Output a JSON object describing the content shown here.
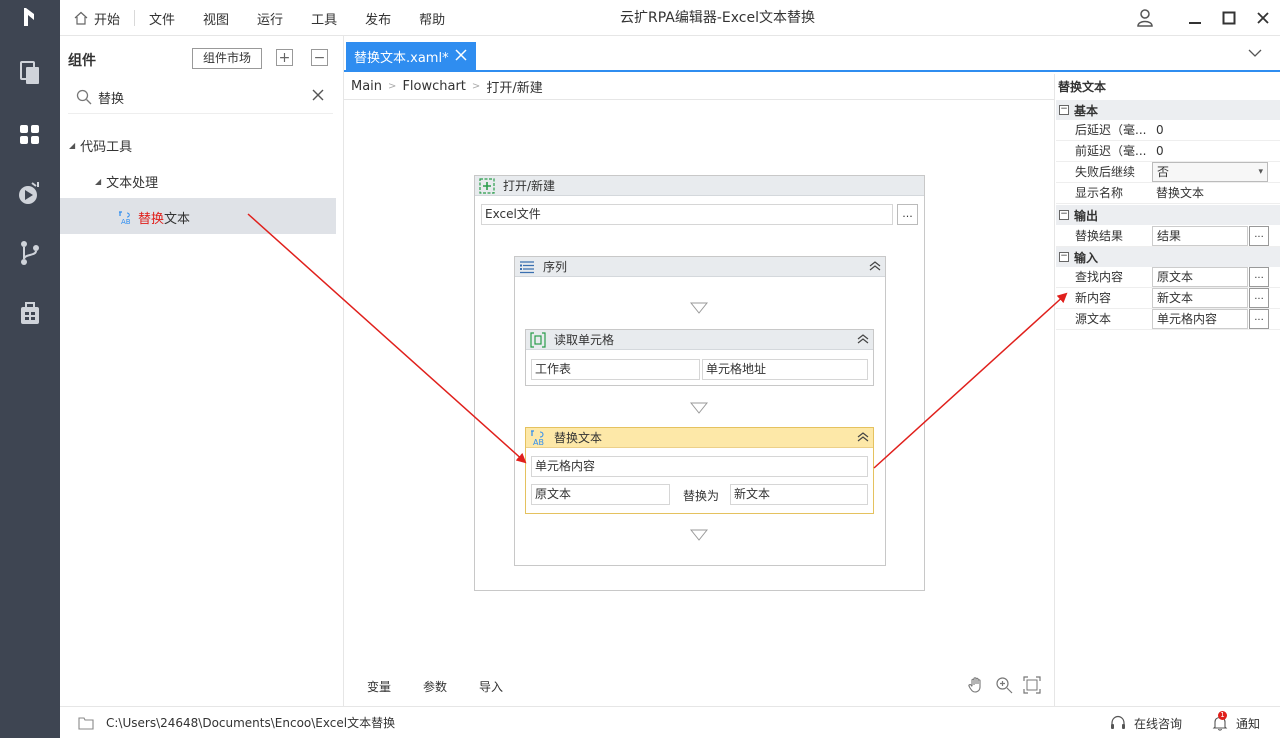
{
  "app": {
    "title": "云扩RPA编辑器-Excel文本替换"
  },
  "menu": {
    "home": "开始",
    "file": "文件",
    "view": "视图",
    "run": "运行",
    "tools": "工具",
    "publish": "发布",
    "help": "帮助"
  },
  "components": {
    "title": "组件",
    "market": "组件市场",
    "search_value": "替换",
    "tree": {
      "code_tools": "代码工具",
      "text_processing": "文本处理",
      "item_hl": "替换",
      "item_rest": "文本"
    }
  },
  "editor": {
    "tab": "替换文本.xaml*",
    "breadcrumb": [
      "Main",
      "Flowchart",
      "打开/新建"
    ],
    "open": {
      "title": "打开/新建",
      "file": "Excel文件",
      "dots": "..."
    },
    "sequence": {
      "title": "序列"
    },
    "read": {
      "title": "读取单元格",
      "sheet": "工作表",
      "address": "单元格地址"
    },
    "replace": {
      "title": "替换文本",
      "source": "单元格内容",
      "find": "原文本",
      "replace_with": "替换为",
      "new": "新文本"
    },
    "bottom_tabs": [
      "变量",
      "参数",
      "导入"
    ]
  },
  "props": {
    "title": "替换文本",
    "sections": {
      "basic": "基本",
      "output": "输出",
      "input": "输入"
    },
    "basic": [
      {
        "label": "后延迟（毫...",
        "value": "0"
      },
      {
        "label": "前延迟（毫...",
        "value": "0"
      },
      {
        "label": "失败后继续",
        "value": "否"
      },
      {
        "label": "显示名称",
        "value": "替换文本"
      }
    ],
    "output": [
      {
        "label": "替换结果",
        "value": "结果"
      }
    ],
    "input": [
      {
        "label": "查找内容",
        "value": "原文本"
      },
      {
        "label": "新内容",
        "value": "新文本"
      },
      {
        "label": "源文本",
        "value": "单元格内容"
      }
    ],
    "dots": "..."
  },
  "status": {
    "path": "C:\\Users\\24648\\Documents\\Encoo\\Excel文本替换",
    "consult": "在线咨询",
    "notify": "通知",
    "notify_count": "1"
  },
  "colors": {
    "accent": "#2f8df0",
    "rail": "#3e4552",
    "highlight": "#e0201c",
    "replace_header": "#fde8a8"
  }
}
